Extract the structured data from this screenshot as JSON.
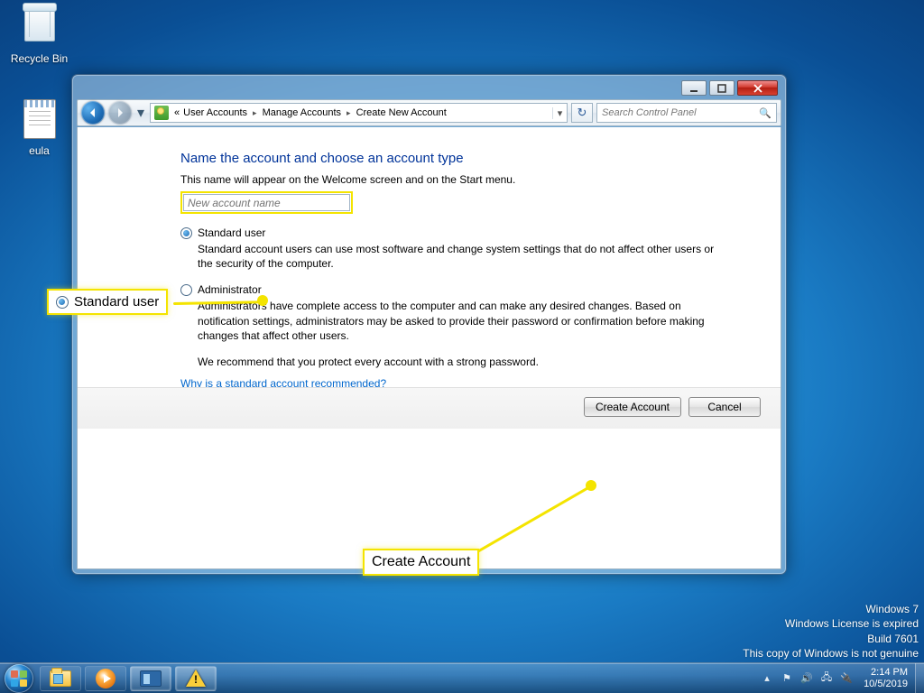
{
  "desktop": {
    "recycle_bin": "Recycle Bin",
    "eula": "eula"
  },
  "window": {
    "breadcrumbs": {
      "prefix": "«",
      "seg1": "User Accounts",
      "seg2": "Manage Accounts",
      "seg3": "Create New Account"
    },
    "search_placeholder": "Search Control Panel"
  },
  "page": {
    "heading": "Name the account and choose an account type",
    "helper": "This name will appear on the Welcome screen and on the Start menu.",
    "input_placeholder": "New account name",
    "standard": {
      "title": "Standard user",
      "desc": "Standard account users can use most software and change system settings that do not affect other users or the security of the computer."
    },
    "admin": {
      "title": "Administrator",
      "desc": "Administrators have complete access to the computer and can make any desired changes. Based on notification settings, administrators may be asked to provide their password or confirmation before making changes that affect other users."
    },
    "recommend": "We recommend that you protect every account with a strong password.",
    "link": "Why is a standard account recommended?",
    "create_btn": "Create Account",
    "cancel_btn": "Cancel"
  },
  "callouts": {
    "standard": "Standard user",
    "create": "Create Account"
  },
  "watermark": {
    "l1": "Windows 7",
    "l2": "Windows License is expired",
    "l3": "Build 7601",
    "l4": "This copy of Windows is not genuine"
  },
  "tray": {
    "time": "2:14 PM",
    "date": "10/5/2019"
  }
}
